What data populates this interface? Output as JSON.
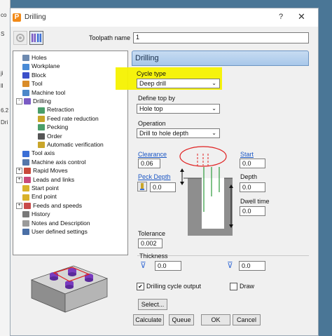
{
  "window": {
    "title": "Drilling",
    "help": "?",
    "close": "✕"
  },
  "toolpath": {
    "label": "Toolpath name",
    "value": "1"
  },
  "tree": [
    {
      "label": "Holes",
      "color": "#6d8ab0",
      "exp": ""
    },
    {
      "label": "Workplane",
      "color": "#4a8bd6",
      "exp": ""
    },
    {
      "label": "Block",
      "color": "#3b4fc9",
      "exp": ""
    },
    {
      "label": "Tool",
      "color": "#d98c2a",
      "exp": ""
    },
    {
      "label": "Machine tool",
      "color": "#4d88c9",
      "exp": ""
    },
    {
      "label": "Drilling",
      "color": "#7a5bc4",
      "exp": "-"
    },
    {
      "label": "Retraction",
      "color": "#4a9e6a",
      "exp": ""
    },
    {
      "label": "Feed rate reduction",
      "color": "#c9a62a",
      "exp": ""
    },
    {
      "label": "Pecking",
      "color": "#4a9e6a",
      "exp": ""
    },
    {
      "label": "Order",
      "color": "#555555",
      "exp": ""
    },
    {
      "label": "Automatic verification",
      "color": "#c9a62a",
      "exp": ""
    },
    {
      "label": "Tool axis",
      "color": "#3b6fd6",
      "exp": ""
    },
    {
      "label": "Machine axis control",
      "color": "#5577aa",
      "exp": ""
    },
    {
      "label": "Rapid Moves",
      "color": "#c94a3b",
      "exp": "+"
    },
    {
      "label": "Leads and links",
      "color": "#c94a7a",
      "exp": "+"
    },
    {
      "label": "Start point",
      "color": "#d9b22a",
      "exp": ""
    },
    {
      "label": "End point",
      "color": "#d9b22a",
      "exp": ""
    },
    {
      "label": "Feeds and speeds",
      "color": "#c94a4a",
      "exp": "+"
    },
    {
      "label": "History",
      "color": "#7a7a7a",
      "exp": ""
    },
    {
      "label": "Notes and Description",
      "color": "#9a9a9a",
      "exp": ""
    },
    {
      "label": "User defined settings",
      "color": "#4a6fa6",
      "exp": ""
    }
  ],
  "panel": {
    "header": "Drilling",
    "cycle_type_label": "Cycle type",
    "cycle_type_value": "Deep drill",
    "top_label": "Define top by",
    "top_value": "Hole top",
    "operation_label": "Operation",
    "operation_value": "Drill to hole depth",
    "clearance_label": "Clearance",
    "clearance_value": "0.06",
    "start_label": "Start",
    "start_value": "0.0",
    "peck_label": "Peck Depth",
    "peck_value": "0.0",
    "depth_label": "Depth",
    "depth_value": "0.0",
    "dwell_label": "Dwell time",
    "dwell_value": "0.0",
    "tolerance_label": "Tolerance",
    "tolerance_value": "0.002",
    "thickness_label": "Thickness",
    "thickness_1": "0.0",
    "thickness_2": "0.0",
    "cycle_output_label": "Drilling cycle output",
    "cycle_output_checked": "✔",
    "draw_label": "Draw",
    "select_label": "Select..."
  },
  "buttons": {
    "calculate": "Calculate",
    "queue": "Queue",
    "ok": "OK",
    "cancel": "Cancel"
  },
  "background": {
    "strip": [
      "co",
      "S",
      "ji",
      "ll",
      "6.2",
      "Dri"
    ]
  }
}
